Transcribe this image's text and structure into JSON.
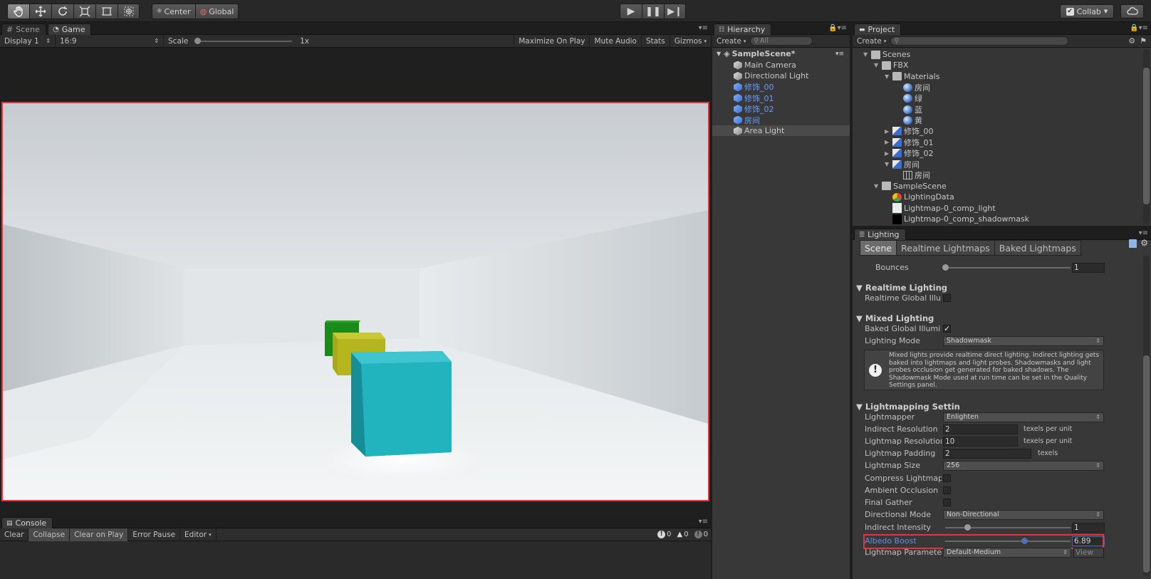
{
  "toolbar": {
    "pivot_label": "Center",
    "space_label": "Global",
    "collab_label": "Collab"
  },
  "game": {
    "tab_scene": "Scene",
    "tab_game": "Game",
    "display": "Display 1",
    "aspect": "16:9",
    "scale_label": "Scale",
    "scale_value": "1x",
    "maximize": "Maximize On Play",
    "mute": "Mute Audio",
    "stats": "Stats",
    "gizmos": "Gizmos"
  },
  "console": {
    "tab": "Console",
    "clear": "Clear",
    "collapse": "Collapse",
    "clear_on_play": "Clear on Play",
    "error_pause": "Error Pause",
    "editor": "Editor",
    "info_count": "0",
    "warn_count": "0",
    "error_count": "0"
  },
  "hierarchy": {
    "tab": "Hierarchy",
    "create": "Create",
    "search_placeholder": "All",
    "scene_name": "SampleScene*",
    "items": [
      {
        "label": "Main Camera",
        "prefab": false
      },
      {
        "label": "Directional Light",
        "prefab": false
      },
      {
        "label": "修饰_00",
        "prefab": true
      },
      {
        "label": "修饰_01",
        "prefab": true
      },
      {
        "label": "修饰_02",
        "prefab": true
      },
      {
        "label": "房间",
        "prefab": true
      },
      {
        "label": "Area Light",
        "prefab": false
      }
    ]
  },
  "project": {
    "tab": "Project",
    "create": "Create",
    "tree": [
      {
        "label": "Scenes",
        "type": "folder",
        "expanded": true
      },
      {
        "label": "FBX",
        "type": "folder",
        "expanded": true
      },
      {
        "label": "Materials",
        "type": "folder",
        "expanded": true
      },
      {
        "label": "房间",
        "type": "material"
      },
      {
        "label": "绿",
        "type": "material"
      },
      {
        "label": "蓝",
        "type": "material"
      },
      {
        "label": "黄",
        "type": "material"
      },
      {
        "label": "修饰_00",
        "type": "model"
      },
      {
        "label": "修饰_01",
        "type": "model"
      },
      {
        "label": "修饰_02",
        "type": "model"
      },
      {
        "label": "房间",
        "type": "model"
      },
      {
        "label": "房间",
        "type": "mesh"
      },
      {
        "label": "SampleScene",
        "type": "folder",
        "expanded": true
      },
      {
        "label": "LightingData",
        "type": "lighting"
      },
      {
        "label": "Lightmap-0_comp_light",
        "type": "texture-light"
      },
      {
        "label": "Lightmap-0_comp_shadowmask",
        "type": "texture-dark"
      }
    ]
  },
  "lighting": {
    "tab": "Lighting",
    "tabs": [
      "Scene",
      "Realtime Lightmaps",
      "Baked Lightmaps"
    ],
    "bounces_label": "Bounces",
    "bounces_value": "1",
    "realtime_header": "Realtime Lighting",
    "realtime_gi_label": "Realtime Global Illu",
    "realtime_gi_checked": false,
    "mixed_header": "Mixed Lighting",
    "baked_gi_label": "Baked Global Illumi",
    "baked_gi_checked": true,
    "lighting_mode_label": "Lighting Mode",
    "lighting_mode_value": "Shadowmask",
    "help_text": "Mixed lights provide realtime direct lighting. Indirect lighting gets baked into lightmaps and light probes. Shadowmasks and light probes occlusion get generated for baked shadows. The Shadowmask Mode used at run time can be set in the Quality Settings panel.",
    "lm_header": "Lightmapping Settin",
    "lightmapper_label": "Lightmapper",
    "lightmapper_value": "Enlighten",
    "indirect_res_label": "Indirect Resolution",
    "indirect_res_value": "2",
    "indirect_res_unit": "texels per unit",
    "lm_res_label": "Lightmap Resolutior",
    "lm_res_value": "10",
    "lm_res_unit": "texels per unit",
    "lm_padding_label": "Lightmap Padding",
    "lm_padding_value": "2",
    "lm_padding_unit": "texels",
    "lm_size_label": "Lightmap Size",
    "lm_size_value": "256",
    "compress_label": "Compress Lightmap",
    "ao_label": "Ambient Occlusion",
    "final_gather_label": "Final Gather",
    "dir_mode_label": "Directional Mode",
    "dir_mode_value": "Non-Directional",
    "indirect_intensity_label": "Indirect Intensity",
    "indirect_intensity_value": "1",
    "albedo_boost_label": "Albedo Boost",
    "albedo_boost_value": "6.89",
    "lm_params_label": "Lightmap Paramete",
    "lm_params_value": "Default-Medium",
    "view_label": "View"
  },
  "colors": {
    "highlight": "#e4363a",
    "prefab_text": "#6a9cff",
    "cube_cyan": "#21b3be",
    "cube_yellow": "#b5b51e",
    "cube_green": "#1a8a18"
  }
}
